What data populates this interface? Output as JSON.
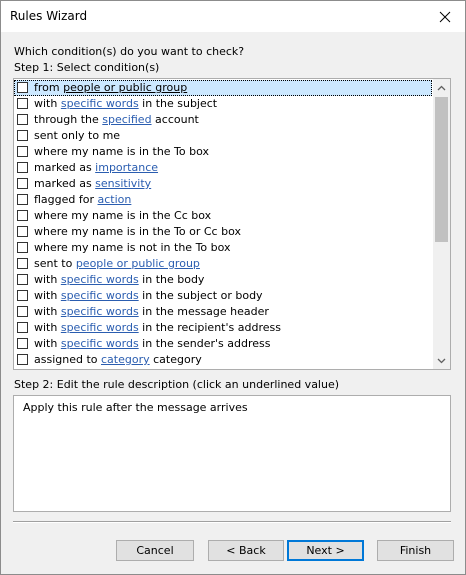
{
  "window": {
    "title": "Rules Wizard"
  },
  "question": "Which condition(s) do you want to check?",
  "step1_label": "Step 1: Select condition(s)",
  "conditions": [
    {
      "parts": [
        {
          "t": "from "
        },
        {
          "t": "people or public group",
          "link": true
        }
      ],
      "selected": true
    },
    {
      "parts": [
        {
          "t": "with "
        },
        {
          "t": "specific words",
          "link": true
        },
        {
          "t": " in the subject"
        }
      ]
    },
    {
      "parts": [
        {
          "t": "through the "
        },
        {
          "t": "specified",
          "link": true
        },
        {
          "t": " account"
        }
      ]
    },
    {
      "parts": [
        {
          "t": "sent only to me"
        }
      ]
    },
    {
      "parts": [
        {
          "t": "where my name is in the To box"
        }
      ]
    },
    {
      "parts": [
        {
          "t": "marked as "
        },
        {
          "t": "importance",
          "link": true
        }
      ]
    },
    {
      "parts": [
        {
          "t": "marked as "
        },
        {
          "t": "sensitivity",
          "link": true
        }
      ]
    },
    {
      "parts": [
        {
          "t": "flagged for "
        },
        {
          "t": "action",
          "link": true
        }
      ]
    },
    {
      "parts": [
        {
          "t": "where my name is in the Cc box"
        }
      ]
    },
    {
      "parts": [
        {
          "t": "where my name is in the To or Cc box"
        }
      ]
    },
    {
      "parts": [
        {
          "t": "where my name is not in the To box"
        }
      ]
    },
    {
      "parts": [
        {
          "t": "sent to "
        },
        {
          "t": "people or public group",
          "link": true
        }
      ]
    },
    {
      "parts": [
        {
          "t": "with "
        },
        {
          "t": "specific words",
          "link": true
        },
        {
          "t": " in the body"
        }
      ]
    },
    {
      "parts": [
        {
          "t": "with "
        },
        {
          "t": "specific words",
          "link": true
        },
        {
          "t": " in the subject or body"
        }
      ]
    },
    {
      "parts": [
        {
          "t": "with "
        },
        {
          "t": "specific words",
          "link": true
        },
        {
          "t": " in the message header"
        }
      ]
    },
    {
      "parts": [
        {
          "t": "with "
        },
        {
          "t": "specific words",
          "link": true
        },
        {
          "t": " in the recipient's address"
        }
      ]
    },
    {
      "parts": [
        {
          "t": "with "
        },
        {
          "t": "specific words",
          "link": true
        },
        {
          "t": " in the sender's address"
        }
      ]
    },
    {
      "parts": [
        {
          "t": "assigned to "
        },
        {
          "t": "category",
          "link": true
        },
        {
          "t": " category"
        }
      ]
    }
  ],
  "step2_label": "Step 2: Edit the rule description (click an underlined value)",
  "description": "Apply this rule after the message arrives",
  "buttons": {
    "cancel": "Cancel",
    "back": "< Back",
    "next": "Next >",
    "finish": "Finish"
  },
  "colors": {
    "link": "#2a5db0",
    "selection": "#cce8ff",
    "default_button_border": "#0078d7"
  },
  "icons": {
    "close": "close-icon",
    "scroll_up": "chevron-up-icon",
    "scroll_down": "chevron-down-icon"
  }
}
